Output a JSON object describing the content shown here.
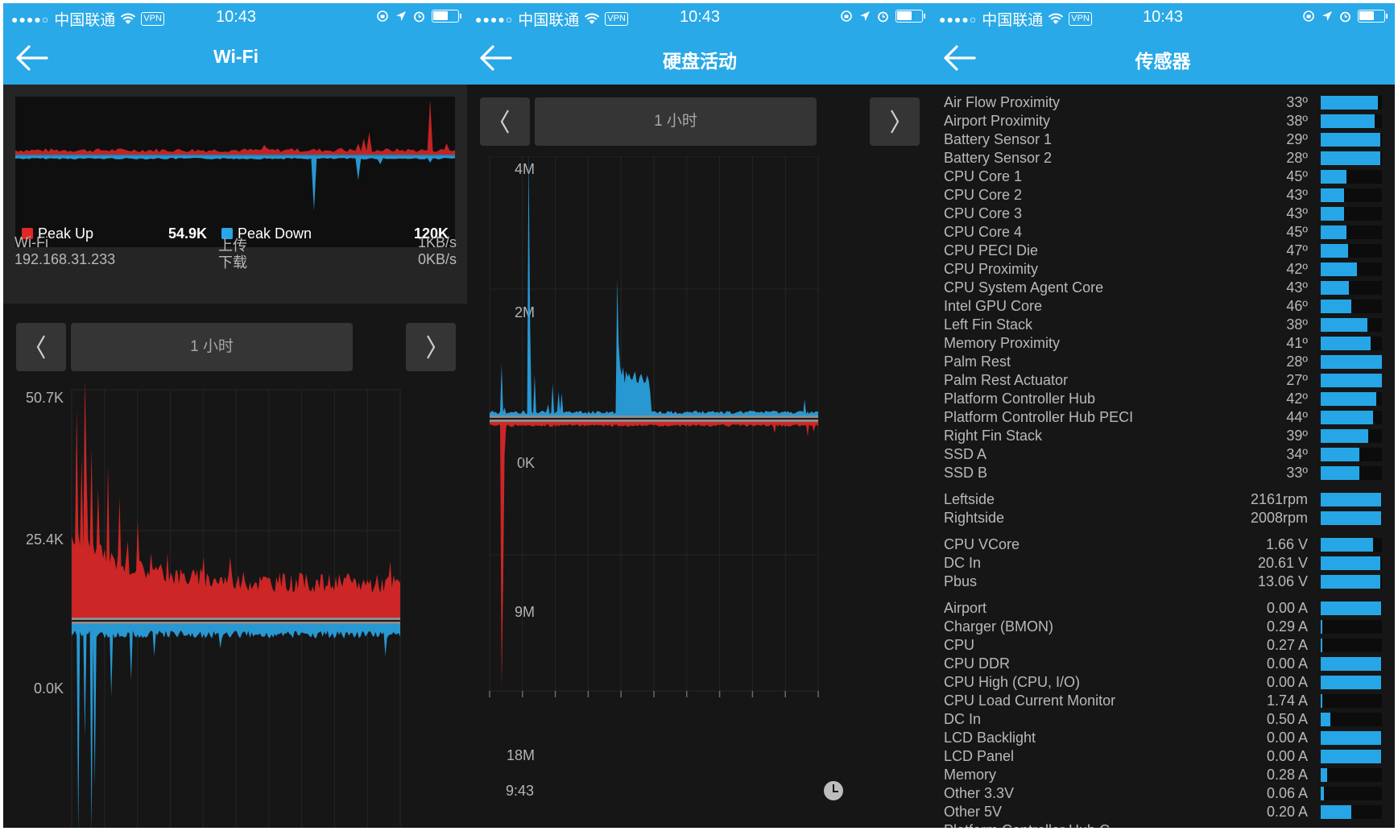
{
  "status_bar": {
    "signal": "●●●●○",
    "carrier": "中国联通",
    "vpn": "VPN",
    "time": "10:43",
    "battery_level": 0.62
  },
  "wifi_panel": {
    "title": "Wi-Fi",
    "legend": {
      "up_label": "Peak Up",
      "up_value": "54.9K",
      "down_label": "Peak Down",
      "down_value": "120K",
      "up_color": "#e02828",
      "down_color": "#2aa6e8"
    },
    "interface_name": "Wi-Fi",
    "ip_address": "192.168.31.233",
    "upload_label": "上传",
    "download_label": "下载",
    "upload_rate": "1KB/s",
    "download_rate": "0KB/s",
    "period": "1 小时",
    "y_labels": [
      "50.7K",
      "25.4K",
      "0.0K"
    ]
  },
  "disk_panel": {
    "title": "硬盘活动",
    "period": "1 小时",
    "y_labels": [
      "4M",
      "2M",
      "0K",
      "9M",
      "18M"
    ],
    "x_start": "9:43"
  },
  "sensor_panel": {
    "title": "传感器",
    "groups": [
      [
        {
          "name": "Air Flow Proximity",
          "value": "33º",
          "level": 0.93
        },
        {
          "name": "Airport Proximity",
          "value": "38º",
          "level": 0.88
        },
        {
          "name": "Battery Sensor 1",
          "value": "29º",
          "level": 0.97
        },
        {
          "name": "Battery Sensor 2",
          "value": "28º",
          "level": 0.97
        },
        {
          "name": "CPU Core 1",
          "value": "45º",
          "level": 0.42
        },
        {
          "name": "CPU Core 2",
          "value": "43º",
          "level": 0.38
        },
        {
          "name": "CPU Core 3",
          "value": "43º",
          "level": 0.38
        },
        {
          "name": "CPU Core 4",
          "value": "45º",
          "level": 0.42
        },
        {
          "name": "CPU PECI Die",
          "value": "47º",
          "level": 0.45
        },
        {
          "name": "CPU Proximity",
          "value": "42º",
          "level": 0.59
        },
        {
          "name": "CPU System Agent Core",
          "value": "43º",
          "level": 0.46
        },
        {
          "name": "Intel GPU Core",
          "value": "46º",
          "level": 0.5
        },
        {
          "name": "Left Fin Stack",
          "value": "38º",
          "level": 0.76
        },
        {
          "name": "Memory Proximity",
          "value": "41º",
          "level": 0.82
        },
        {
          "name": "Palm Rest",
          "value": "28º",
          "level": 1.0
        },
        {
          "name": "Palm Rest Actuator",
          "value": "27º",
          "level": 1.0
        },
        {
          "name": "Platform Controller Hub",
          "value": "42º",
          "level": 0.91
        },
        {
          "name": "Platform Controller Hub PECI",
          "value": "44º",
          "level": 0.86
        },
        {
          "name": "Right Fin Stack",
          "value": "39º",
          "level": 0.78
        },
        {
          "name": "SSD A",
          "value": "34º",
          "level": 0.63
        },
        {
          "name": "SSD B",
          "value": "33º",
          "level": 0.63
        }
      ],
      [
        {
          "name": "Leftside",
          "value": "2161rpm",
          "level": 0.99
        },
        {
          "name": "Rightside",
          "value": "2008rpm",
          "level": 0.99
        }
      ],
      [
        {
          "name": "CPU VCore",
          "value": "1.66 V",
          "level": 0.86
        },
        {
          "name": "DC In",
          "value": "20.61 V",
          "level": 0.97
        },
        {
          "name": "Pbus",
          "value": "13.06 V",
          "level": 0.97
        }
      ],
      [
        {
          "name": "Airport",
          "value": "0.00 A",
          "level": 0.99
        },
        {
          "name": "Charger (BMON)",
          "value": "0.29 A",
          "level": 0.03
        },
        {
          "name": "CPU",
          "value": "0.27 A",
          "level": 0.03
        },
        {
          "name": "CPU DDR",
          "value": "0.00 A",
          "level": 0.99
        },
        {
          "name": "CPU High (CPU, I/O)",
          "value": "0.00 A",
          "level": 0.99
        },
        {
          "name": "CPU Load Current Monitor",
          "value": "1.74 A",
          "level": 0.03
        },
        {
          "name": "DC In",
          "value": "0.50 A",
          "level": 0.16
        },
        {
          "name": "LCD Backlight",
          "value": "0.00 A",
          "level": 0.99
        },
        {
          "name": "LCD Panel",
          "value": "0.00 A",
          "level": 0.99
        },
        {
          "name": "Memory",
          "value": "0.28 A",
          "level": 0.1
        },
        {
          "name": "Other 3.3V",
          "value": "0.06 A",
          "level": 0.05
        },
        {
          "name": "Other 5V",
          "value": "0.20 A",
          "level": 0.5
        },
        {
          "name": "Platform Controller Hub C",
          "value": "",
          "level": 0.0
        }
      ]
    ]
  }
}
